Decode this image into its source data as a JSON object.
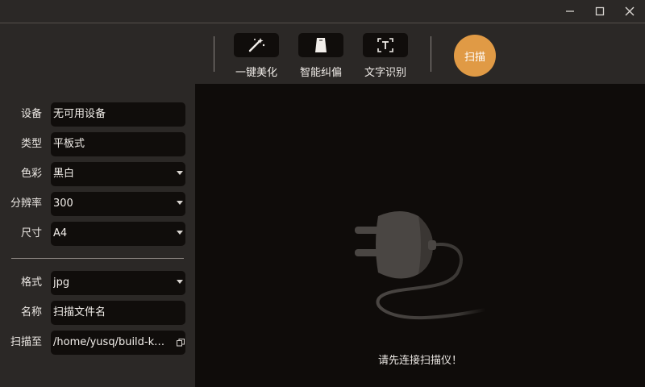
{
  "window": {
    "controls": [
      "minimize-icon",
      "maximize-icon",
      "close-icon"
    ]
  },
  "toolbar": {
    "tools": [
      {
        "label": "一键美化",
        "icon": "magic-wand-icon"
      },
      {
        "label": "智能纠偏",
        "icon": "auto-crop-icon"
      },
      {
        "label": "文字识别",
        "icon": "text-recognition-icon"
      }
    ],
    "scan_label": "扫描",
    "scan_color": "#e09a45"
  },
  "settings": {
    "device": {
      "label": "设备",
      "value": "无可用设备"
    },
    "type": {
      "label": "类型",
      "value": "平板式"
    },
    "color": {
      "label": "色彩",
      "value": "黑白"
    },
    "resolution": {
      "label": "分辨率",
      "value": "300"
    },
    "size": {
      "label": "尺寸",
      "value": "A4"
    },
    "format": {
      "label": "格式",
      "value": "jpg"
    },
    "name": {
      "label": "名称",
      "value": "扫描文件名"
    },
    "save_to": {
      "label": "扫描至",
      "value": "/home/yusq/build-k…"
    }
  },
  "main": {
    "status_text": "请先连接扫描仪！",
    "illustration": "unplugged-icon"
  }
}
